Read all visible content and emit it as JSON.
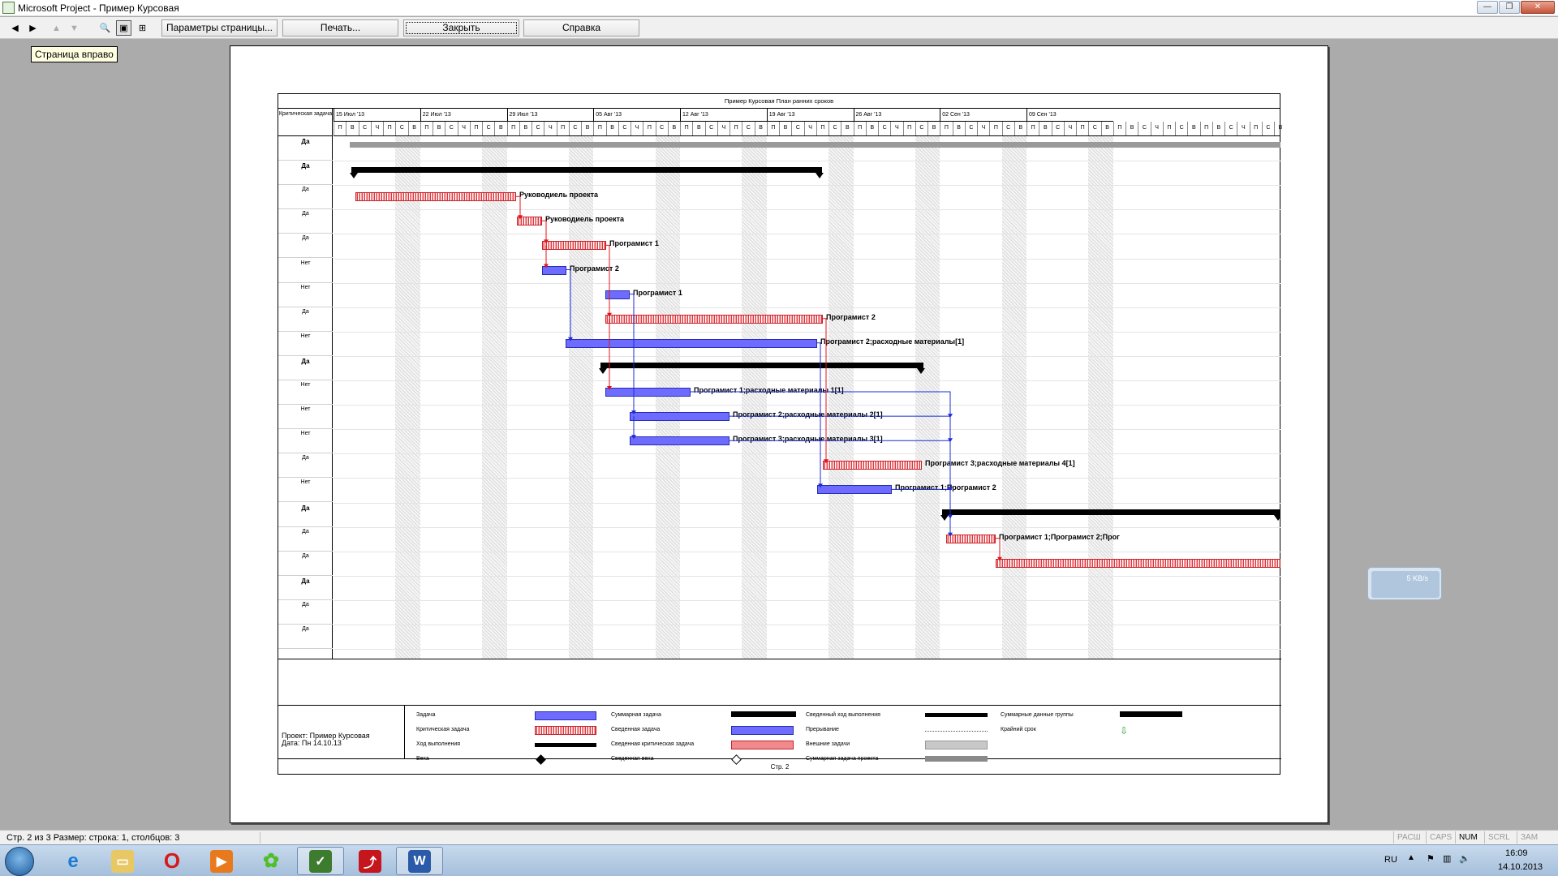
{
  "window": {
    "title": "Microsoft Project - Пример Курсовая",
    "controls": [
      "minimize",
      "maximize",
      "close"
    ]
  },
  "toolbar": {
    "page_setup": "Параметры страницы...",
    "print": "Печать...",
    "close": "Закрыть",
    "help": "Справка"
  },
  "tooltip": "Страница вправо",
  "doc": {
    "header": "Пример Курсовая  План ранних сроков",
    "column_header": "Критическая задача",
    "weeks": [
      "15 Июл '13",
      "22 Июл '13",
      "29 Июл '13",
      "05 Авг '13",
      "12 Авг '13",
      "19 Авг '13",
      "26 Авг '13",
      "02 Сен '13",
      "09 Сен '13"
    ],
    "days": [
      "П",
      "В",
      "С",
      "Ч",
      "П",
      "С",
      "В"
    ],
    "rows": [
      {
        "crit": "Да",
        "bold": true
      },
      {
        "crit": "Да",
        "bold": true
      },
      {
        "crit": "Да",
        "bold": false
      },
      {
        "crit": "Да",
        "bold": false
      },
      {
        "crit": "Да",
        "bold": false
      },
      {
        "crit": "Нет",
        "bold": false
      },
      {
        "crit": "Нет",
        "bold": false
      },
      {
        "crit": "Да",
        "bold": false
      },
      {
        "crit": "Нет",
        "bold": false
      },
      {
        "crit": "Да",
        "bold": true
      },
      {
        "crit": "Нет",
        "bold": false
      },
      {
        "crit": "Нет",
        "bold": false
      },
      {
        "crit": "Нет",
        "bold": false
      },
      {
        "crit": "Да",
        "bold": false
      },
      {
        "crit": "Нет",
        "bold": false
      },
      {
        "crit": "Да",
        "bold": true
      },
      {
        "crit": "Да",
        "bold": false
      },
      {
        "crit": "Да",
        "bold": false
      },
      {
        "crit": "Да",
        "bold": true
      },
      {
        "crit": "Да",
        "bold": false
      },
      {
        "crit": "Да",
        "bold": false
      }
    ],
    "bar_labels": [
      "Руководиель проекта",
      "Руководиель проекта",
      "Програмист 1",
      "Програмист 2",
      "Програмист 1",
      "Програмист 2",
      "Програмист 2;расходные материалы[1]",
      "Програмист 1;расходные материалы 1[1]",
      "Програмист 2;расходные материалы 2[1]",
      "Програмист 3;расходные материалы 3[1]",
      "Програмист 3;расходные материалы 4[1]",
      "Програмист 1;Програмист 2",
      "Програмист 1;Програмист 2;Прог"
    ],
    "project_name": "Проект: Пример Курсовая",
    "project_date": "Дата: Пн 14.10.13",
    "legend": {
      "task": "Задача",
      "critical_task": "Критическая задача",
      "progress": "Ход выполнения",
      "milestone": "Веха",
      "summary": "Суммарная задача",
      "rolled_up_task": "Сведенная задача",
      "rolled_up_critical": "Сведенная критическая задача",
      "rolled_up_milestone": "Сведенная веха",
      "rolled_up_progress": "Сведенный ход выполнения",
      "split": "Прерывание",
      "external_tasks": "Внешние задачи",
      "project_summary": "Суммарная задача проекта",
      "group_by_summary": "Суммарные данные группы",
      "deadline": "Крайний срок"
    },
    "page_footer": "Стр. 2"
  },
  "net_widget": {
    "speed": "5 KB/s"
  },
  "status": {
    "left": "Стр. 2 из 3   Размер: строка: 1, столбцов: 3",
    "indicators": [
      "РАСШ",
      "CAPS",
      "NUM",
      "SCRL",
      "ЗАМ"
    ]
  },
  "taskbar": {
    "apps": [
      "explorer",
      "internet-explorer",
      "opera",
      "media-player",
      "icq",
      "ms-project",
      "acrobat",
      "word"
    ],
    "lang": "RU",
    "time": "16:09",
    "date": "14.10.2013"
  },
  "colors": {
    "task_bar": "#6f6bff",
    "critical_bar": "#e0353c",
    "link_blue": "#1e2bd6",
    "link_red": "#e0141c"
  }
}
